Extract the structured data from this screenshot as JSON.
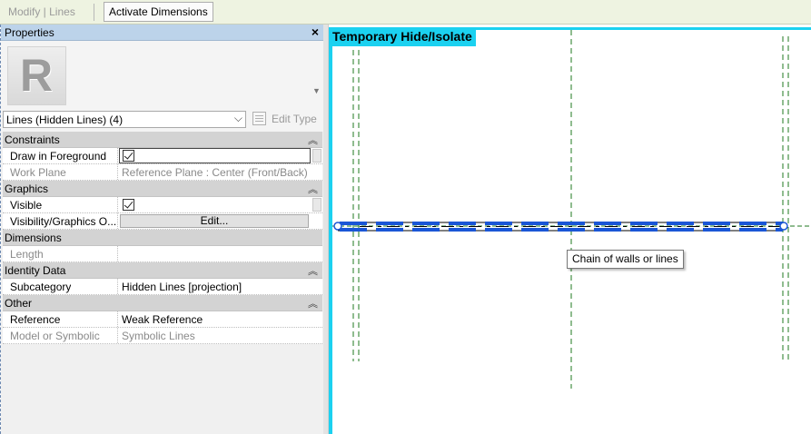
{
  "ribbon": {
    "context_label": "Modify | Lines",
    "activate_dimensions": "Activate Dimensions"
  },
  "properties": {
    "title": "Properties",
    "close_glyph": "×",
    "type_selector": "Lines (Hidden Lines) (4)",
    "edit_type": "Edit Type",
    "thumbnail_letter": "R",
    "categories": [
      {
        "name": "Constraints",
        "rows": [
          {
            "key": "Draw in Foreground",
            "value": "",
            "checked": true
          },
          {
            "key": "Work Plane",
            "value": "Reference Plane : Center (Front/Back)"
          }
        ]
      },
      {
        "name": "Graphics",
        "rows": [
          {
            "key": "Visible",
            "value": "",
            "checked": true
          },
          {
            "key": "Visibility/Graphics O...",
            "value": "Edit..."
          }
        ]
      },
      {
        "name": "Dimensions",
        "rows": [
          {
            "key": "Length",
            "value": ""
          }
        ]
      },
      {
        "name": "Identity Data",
        "rows": [
          {
            "key": "Subcategory",
            "value": "Hidden Lines [projection]"
          }
        ]
      },
      {
        "name": "Other",
        "rows": [
          {
            "key": "Reference",
            "value": "Weak Reference"
          },
          {
            "key": "Model or Symbolic",
            "value": "Symbolic Lines"
          }
        ]
      }
    ]
  },
  "canvas": {
    "mode_label": "Temporary Hide/Isolate",
    "tooltip": "Chain of walls or lines"
  },
  "colors": {
    "isolate_border": "#1bd1f0",
    "reference_plane": "#1f7a1f",
    "selection": "#1a56d6"
  }
}
